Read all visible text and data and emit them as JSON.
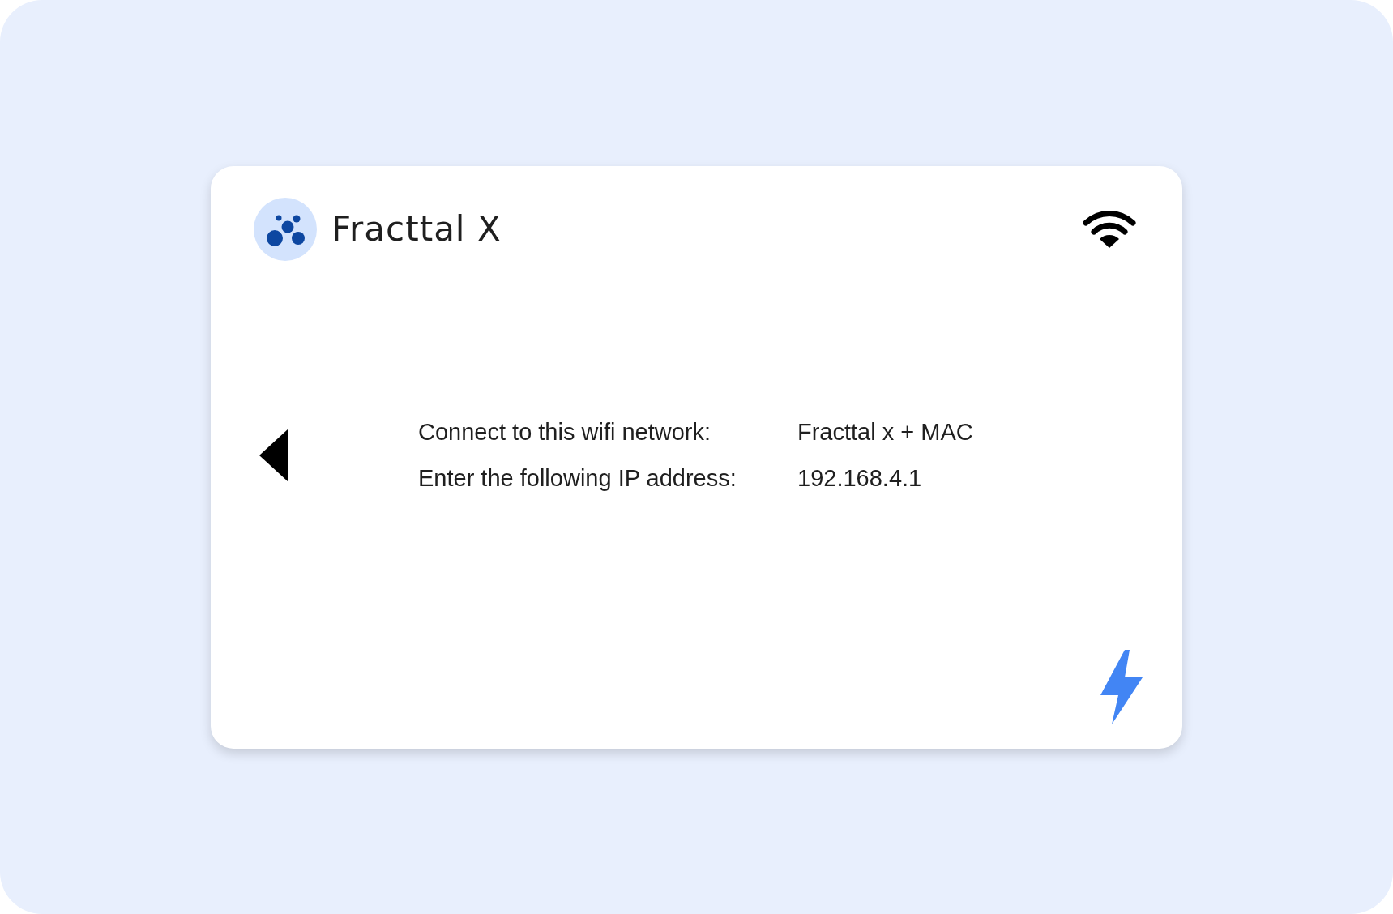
{
  "app": {
    "title": "Fracttal X"
  },
  "instructions": [
    {
      "label": "Connect to this wifi network:",
      "value": "Fracttal x + MAC"
    },
    {
      "label": "Enter the following IP address:",
      "value": "192.168.4.1"
    }
  ]
}
